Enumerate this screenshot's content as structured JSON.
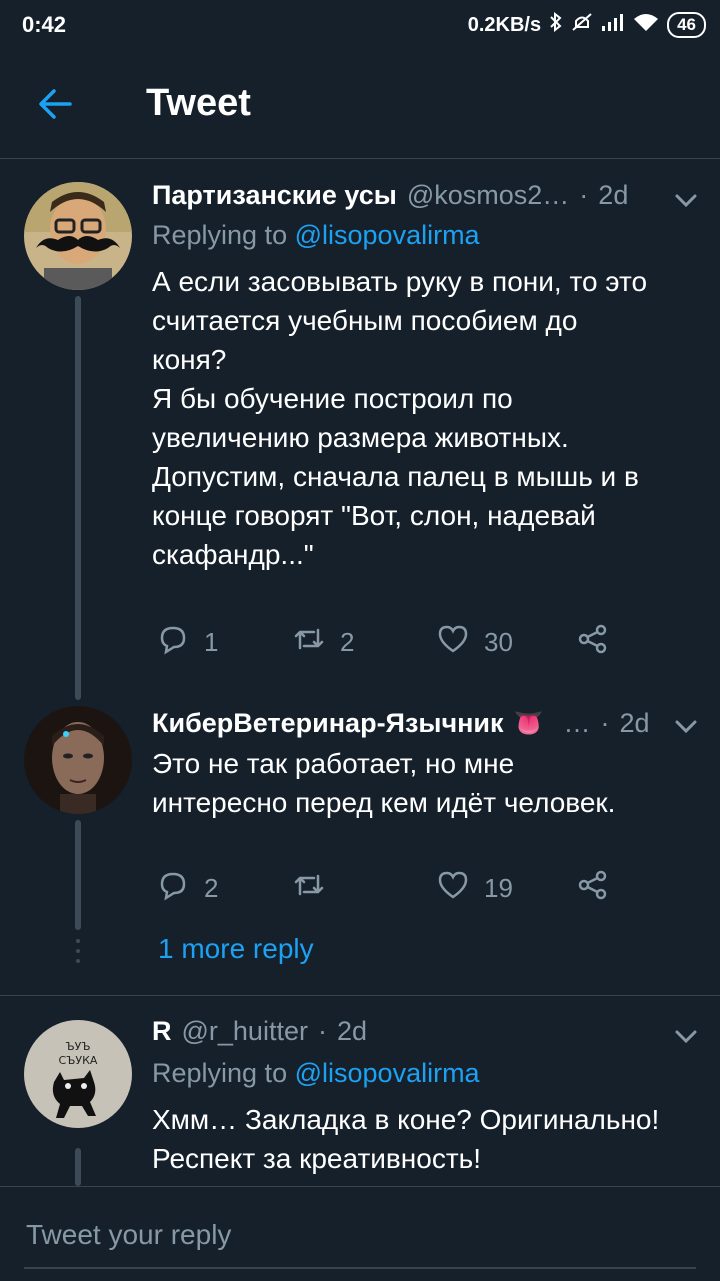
{
  "status_bar": {
    "time": "0:42",
    "network_speed": "0.2KB/s",
    "battery": "46"
  },
  "header": {
    "title": "Tweet",
    "back_icon": "arrow-left-icon"
  },
  "tweets": [
    {
      "name": "Партизанские усы",
      "handle": "@kosmos2…",
      "separator": "·",
      "time": "2d",
      "replying_prefix": "Replying to",
      "replying_to": "@lisopovalirma",
      "text": "А если засовывать руку в пони, то это\nсчитается учебным пособием до\nконя?\nЯ бы обучение построил по\nувеличению размера животных.\nДопустим, сначала палец в мышь и в\nконце говорят \"Вот, слон, надевай\nскафандр...\"",
      "replies": "1",
      "retweets": "2",
      "likes": "30"
    },
    {
      "name": "КиберВетеринар-Язычник",
      "emoji": "👅",
      "handle": "…",
      "separator": "·",
      "time": "2d",
      "text": "Это не так работает, но мне\nинтересно перед кем идёт человек.",
      "replies": "2",
      "retweets": "",
      "likes": "19"
    },
    {
      "name": "R",
      "handle": "@r_huitter",
      "separator": "·",
      "time": "2d",
      "replying_prefix": "Replying to",
      "replying_to": "@lisopovalirma",
      "avatar_text_line1": "ЪУЪ",
      "avatar_text_line2": "СЪУКА",
      "text": "Хмм… Закладка в коне? Оригинально!\nРеспект за креативность!"
    }
  ],
  "more_replies_label": "1 more reply",
  "reply_bar": {
    "placeholder": "Tweet your reply"
  },
  "colors": {
    "background": "#15202b",
    "accent": "#1da1f2",
    "muted": "#8899a6",
    "divider": "#38444d"
  }
}
